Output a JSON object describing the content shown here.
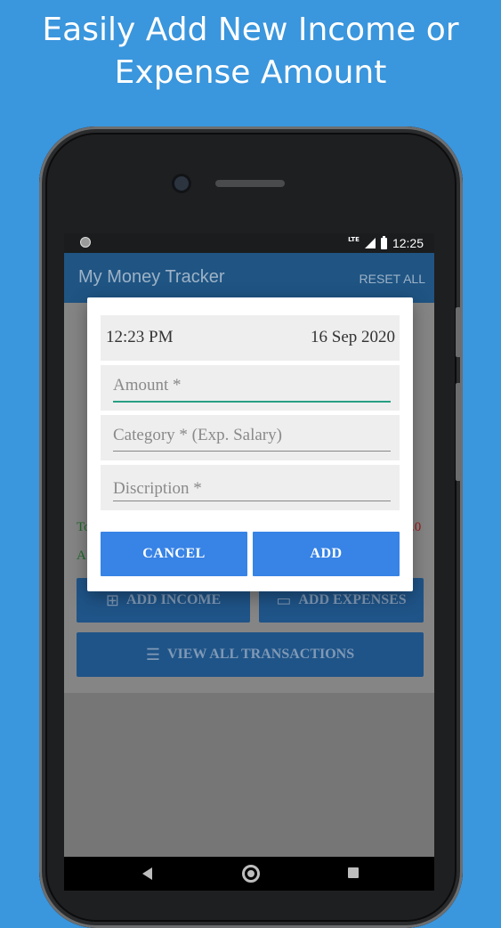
{
  "headline": {
    "line1": "Easily Add New Income or",
    "line2": "Expense Amount"
  },
  "status_bar": {
    "network": "LTE",
    "time": "12:25"
  },
  "app_bar": {
    "title": "My Money Tracker",
    "reset_label": "RESET ALL"
  },
  "background": {
    "total_fragment": "To",
    "total_value_fragment": ".0",
    "available_fragment": "A",
    "add_income_label": "ADD INCOME",
    "add_expenses_label": "ADD EXPENSES",
    "view_all_label": "VIEW ALL TRANSACTIONS"
  },
  "dialog": {
    "time": "12:23 PM",
    "date": "16 Sep 2020",
    "amount_placeholder": "Amount *",
    "category_placeholder": "Category * (Exp. Salary)",
    "description_placeholder": "Discription *",
    "cancel_label": "CANCEL",
    "add_label": "ADD"
  },
  "colors": {
    "page_bg": "#3a96dd",
    "app_bar": "#1f5483",
    "accent_button": "#3783e6",
    "focus_underline": "#27a083",
    "income_text": "#1f6b2a",
    "expense_text": "#a11a1a"
  },
  "icons": {
    "add_income": "plus-box-icon",
    "add_expenses": "credit-card-icon",
    "view_all": "list-icon",
    "nav_back": "triangle-back-icon",
    "nav_home": "circle-home-icon",
    "nav_recent": "square-recent-icon"
  }
}
